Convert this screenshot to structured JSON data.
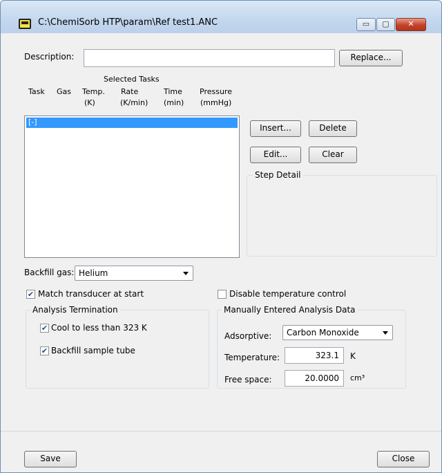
{
  "window": {
    "title": "C:\\ChemiSorb HTP\\param\\Ref test1.ANC",
    "minimize_glyph": "▭",
    "maximize_glyph": "▢",
    "close_glyph": "✕"
  },
  "description": {
    "label": "Description:",
    "value": "",
    "replace_button": "Replace..."
  },
  "tasks": {
    "group_title": "Selected Tasks",
    "columns": [
      {
        "line1": "Task",
        "line2": ""
      },
      {
        "line1": "Gas",
        "line2": ""
      },
      {
        "line1": "Temp.",
        "line2": "(K)"
      },
      {
        "line1": "Rate",
        "line2": "(K/min)"
      },
      {
        "line1": "Time",
        "line2": "(min)"
      },
      {
        "line1": "Pressure",
        "line2": "(mmHg)"
      }
    ],
    "rows": [
      "[-]"
    ],
    "insert_button": "Insert...",
    "delete_button": "Delete",
    "edit_button": "Edit...",
    "clear_button": "Clear",
    "step_detail_title": "Step Detail"
  },
  "backfill": {
    "label": "Backfill gas:",
    "selected": "Helium"
  },
  "match_transducer": {
    "label": "Match transducer at start",
    "checked": true,
    "check_glyph": "✔"
  },
  "disable_temp": {
    "label": "Disable temperature control",
    "checked": false
  },
  "analysis_termination": {
    "title": "Analysis Termination",
    "cool_label": "Cool to less than 323 K",
    "cool_checked": true,
    "backfill_label": "Backfill sample tube",
    "backfill_checked": true
  },
  "manual_data": {
    "title": "Manually Entered Analysis Data",
    "adsorptive_label": "Adsorptive:",
    "adsorptive_value": "Carbon Monoxide",
    "temperature_label": "Temperature:",
    "temperature_value": "323.1",
    "temperature_unit": "K",
    "free_space_label": "Free space:",
    "free_space_value": "20.0000",
    "free_space_unit": "cm³"
  },
  "footer": {
    "save_button": "Save",
    "close_button": "Close"
  }
}
